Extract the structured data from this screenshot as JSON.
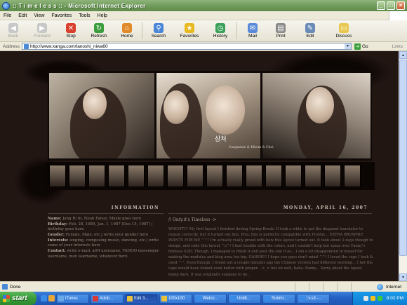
{
  "window": {
    "title": ":: T i m e l e s s :: - Microsoft Internet Explorer",
    "minimize": "_",
    "maximize": "□",
    "close": "×"
  },
  "menubar": [
    "File",
    "Edit",
    "View",
    "Favorites",
    "Tools",
    "Help"
  ],
  "toolbar": {
    "back": "Back",
    "forward": "Forward",
    "stop": "Stop",
    "refresh": "Refresh",
    "home": "Home",
    "search": "Search",
    "favorites": "Favorites",
    "history": "History",
    "mail": "Mail",
    "print": "Print",
    "edit": "Edit",
    "discuss": "Discuss"
  },
  "address": {
    "label": "Address",
    "url": "http://www.xanga.com/tanoshi_niwa60",
    "go": "Go",
    "links": "Links"
  },
  "page": {
    "caption": "상처",
    "caption_sub": "Sungminie & Kibum & Choi",
    "info_header": "INFORMATION",
    "info_lines": [
      {
        "label": "Name:",
        "text": " Jang Ri In, Neah Fanuz, Maxie goes here"
      },
      {
        "label": "Birthday:",
        "text": " Feb. 28, 1989, Jan. 1, 1987 (Dec.15, 1987) | birthday goes here"
      },
      {
        "label": "Gender:",
        "text": " Female, Male, etc.| write your gender here"
      },
      {
        "label": "Interests:",
        "text": " singing, composing music, dancing, etc.| write some of your interests here"
      },
      {
        "label": "Contact:",
        "text": " write e-mail, aIM username, YAHOO messenger username, msn username, whatever here."
      }
    ],
    "date_header": "MONDAY, APRIL 16, 2007",
    "post_title": "// Onty.it's Timeless ->",
    "post_body": "WHOOT!!! My first layout I finished during Spring Break. It took a while to get the diagonal translator to repeat correctly, but it turned out fine. Plus, this is perfectly compatible with Firefox... EXTRA BROWNIE POINTS FOR ME ^^! I'm actually really proud with how this layout turned out. It took about 2 days though to design, and code this layout ^o^! I had trouble with the colors, and I couldn't help but spazz over Fanny's hotness XDD. Though, I managed to finish it and post the one it as... I am a lot disappointed in myself for making the modules and blog area too big. GAHHH!! I hope you guys don't mind ^^! I loved the caps I took & used ^^. Even though, I found out a couple minutes ago the Chinese version had different wording... I bet the caps would have looked even better with proper... >_> but oh well, haha. Fanny... Sorry about the layout being dark. It was originally suppose to be..."
  },
  "status": {
    "text": "Done",
    "zone": "Internet"
  },
  "taskbar": {
    "start": "start",
    "tasks": [
      {
        "label": "iTunes",
        "color": "#6aa8e8"
      },
      {
        "label": "Adob...",
        "color": "#d83a3a"
      },
      {
        "label": "Edit 3...",
        "color": "#e8c23a"
      },
      {
        "label": "100x100",
        "color": "#e8c23a"
      },
      {
        "label": "Welco...",
        "color": "#3a8ae8"
      },
      {
        "label": "Untitl...",
        "color": "#3a8ae8"
      },
      {
        "label": "Submi...",
        "color": "#3a8ae8"
      },
      {
        "label": "::v.s3 -...",
        "color": "#3a8ae8"
      }
    ],
    "clock": "8:02 PM"
  }
}
